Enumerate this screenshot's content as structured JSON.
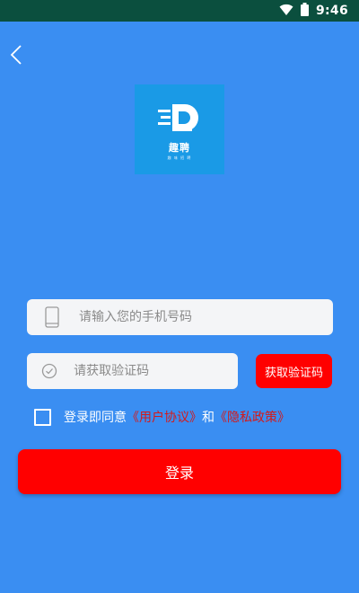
{
  "status_bar": {
    "time": "9:46"
  },
  "header": {
    "back_icon": "chevron-left-icon"
  },
  "logo": {
    "text": "趣聘",
    "subtitle": "趣 味 招 聘"
  },
  "phone_field": {
    "placeholder": "请输入您的手机号码",
    "value": "",
    "icon": "mobile-phone-icon"
  },
  "code_field": {
    "placeholder": "请获取验证码",
    "value": "",
    "icon": "check-circle-icon"
  },
  "get_code_button": {
    "label": "获取验证码"
  },
  "agreement": {
    "prefix": "登录即同意",
    "user_agreement": "《用户协议》",
    "and": "和",
    "privacy_policy": "《隐私政策》"
  },
  "login_button": {
    "label": "登录"
  },
  "colors": {
    "background": "#3a8ef2",
    "status_bar": "#0b4f3e",
    "accent_red": "#ff0000",
    "link_red": "#d41a1a",
    "logo_bg": "#1a9ae6"
  }
}
